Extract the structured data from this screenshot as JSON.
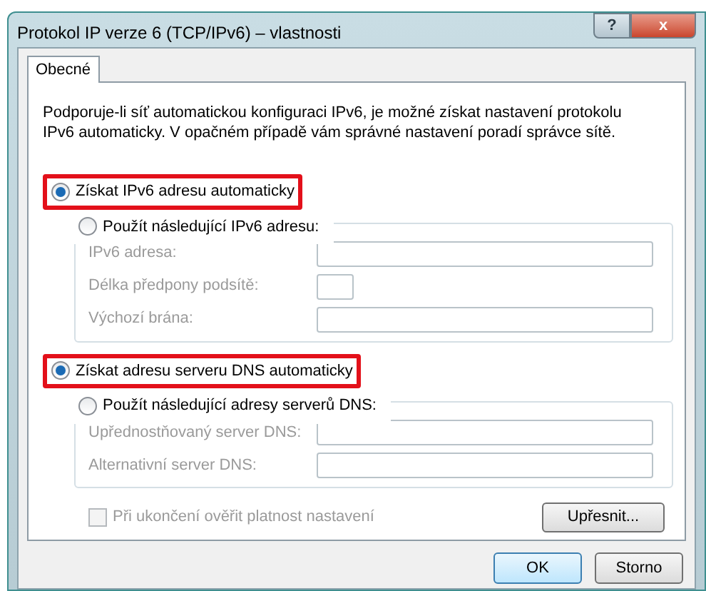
{
  "window": {
    "title": "Protokol IP verze 6 (TCP/IPv6) – vlastnosti",
    "controls": [
      {
        "label": "?",
        "kind": "help"
      },
      {
        "label": "x",
        "kind": "close"
      }
    ]
  },
  "tabs": [
    {
      "label": "Obecné",
      "selected": true
    }
  ],
  "description": "Podporuje-li síť automatickou konfiguraci IPv6, je možné získat nastavení protokolu IPv6 automaticky. V opačném případě vám správné nastavení poradí správce sítě.",
  "sections": [
    {
      "auto_option": {
        "label": "Získat IPv6 adresu automaticky",
        "selected": true,
        "highlighted": true
      },
      "manual_option": {
        "label": "Použít následující IPv6 adresu:",
        "selected": false
      },
      "fields": [
        {
          "label": "IPv6 adresa:",
          "kind": "wide",
          "disabled": true
        },
        {
          "label": "Délka předpony podsítě:",
          "kind": "short",
          "disabled": true
        },
        {
          "label": "Výchozí brána:",
          "kind": "wide",
          "disabled": true
        }
      ]
    },
    {
      "auto_option": {
        "label": "Získat adresu serveru DNS automaticky",
        "selected": true,
        "highlighted": true
      },
      "manual_option": {
        "label": "Použít následující adresy serverů DNS:",
        "selected": false
      },
      "fields": [
        {
          "label": "Upřednostňovaný server DNS:",
          "kind": "wide",
          "disabled": true
        },
        {
          "label": "Alternativní server DNS:",
          "kind": "wide",
          "disabled": true
        }
      ]
    }
  ],
  "validate_checkbox": {
    "label": "Při ukončení ověřit platnost nastavení",
    "checked": false,
    "disabled": true
  },
  "advanced_button": "Upřesnit...",
  "buttons": [
    {
      "label": "OK",
      "default": true
    },
    {
      "label": "Storno",
      "default": false
    }
  ]
}
